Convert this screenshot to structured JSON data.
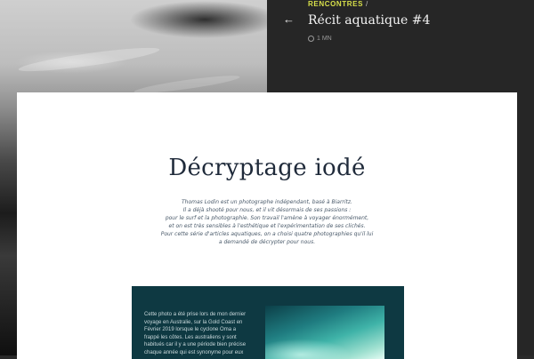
{
  "header": {
    "category": "RENCONTRES",
    "separator": "/",
    "title": "Récit aquatique #4",
    "read_time": "1 MN"
  },
  "article": {
    "title": "Décryptage iodé",
    "intro_lines": [
      "Thomas Lodin est un photographe indépendant, basé à Biarritz.",
      "Il a déjà shooté pour nous, et il vit désormais de ses passions :",
      "pour le surf et la photographie. Son travail l'amène à voyager énormément,",
      "et on est très sensibles à l'esthétique et l'expérimentation de ses clichés.",
      "Pour cette série d'articles aquatiques, on a choisi quatre photographies qu'il lui",
      "a demandé de décrypter pour nous."
    ],
    "feature_lines": [
      "Cette photo a été prise lors de mon dernier",
      "voyage en Australie, sur la Gold Coast en",
      "Février 2019 lorsque le cyclone Oma a",
      "frappé les côtes. Les australiens y sont",
      "habitués car il y a une période bien précise",
      "chaque année qui est synonyme pour eux"
    ]
  },
  "icons": {
    "back": "arrow-left-icon",
    "clock": "clock-icon"
  },
  "colors": {
    "accent": "#d8e04a",
    "panel": "#262626",
    "feature_bg": "#0e3942",
    "title": "#1f2a3a"
  }
}
